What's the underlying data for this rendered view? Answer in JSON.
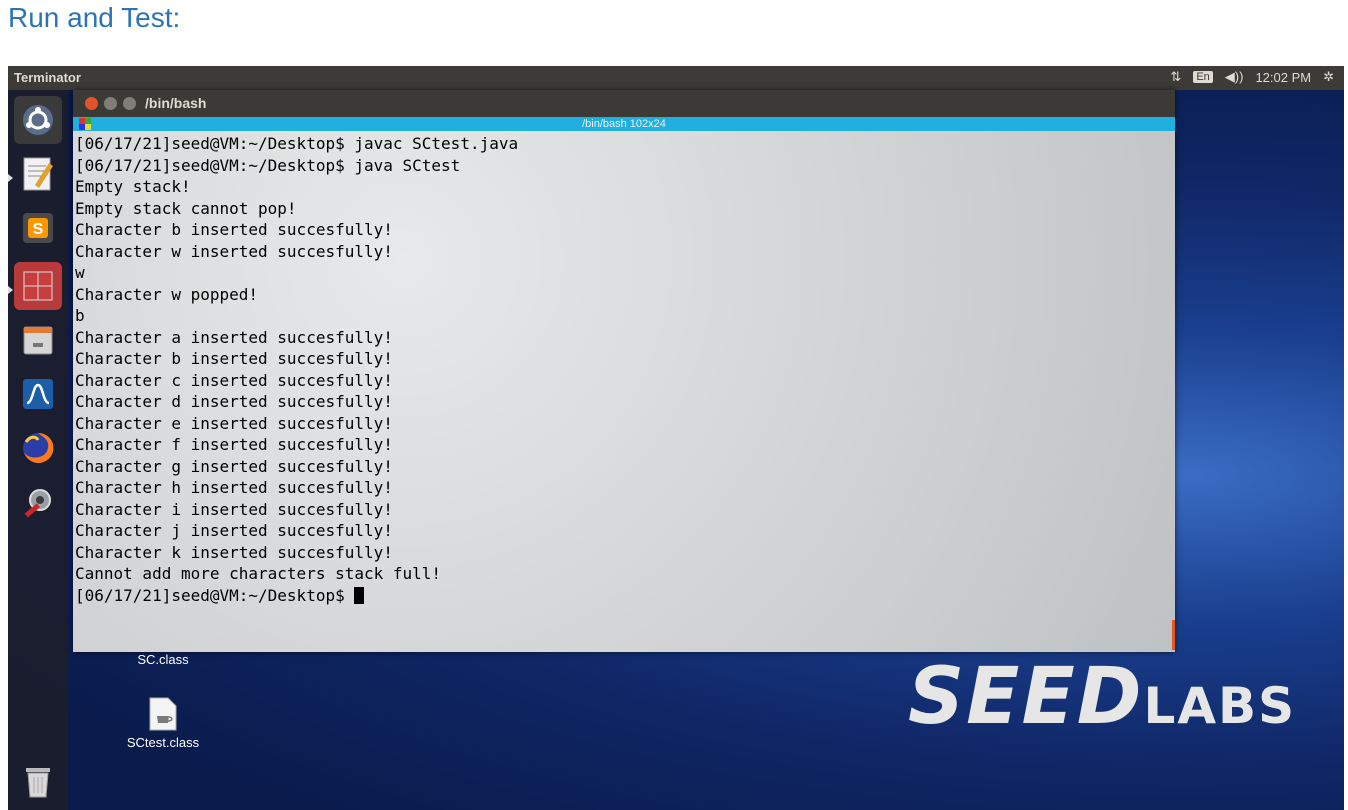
{
  "page": {
    "heading": "Run and Test:"
  },
  "topbar": {
    "app_title": "Terminator",
    "lang": "En",
    "time": "12:02 PM"
  },
  "launcher": {
    "items": [
      {
        "name": "ubuntu-logo-icon"
      },
      {
        "name": "text-editor-icon"
      },
      {
        "name": "sublime-text-icon"
      },
      {
        "name": "terminator-icon"
      },
      {
        "name": "file-manager-icon"
      },
      {
        "name": "wireshark-icon"
      },
      {
        "name": "firefox-icon"
      },
      {
        "name": "settings-icon"
      },
      {
        "name": "trash-icon"
      }
    ]
  },
  "window": {
    "title": "/bin/bash",
    "tab_title": "/bin/bash 102x24"
  },
  "terminal": {
    "lines": [
      "[06/17/21]seed@VM:~/Desktop$ javac SCtest.java",
      "[06/17/21]seed@VM:~/Desktop$ java SCtest",
      "Empty stack!",
      "Empty stack cannot pop!",
      "Character b inserted succesfully!",
      "Character w inserted succesfully!",
      "w",
      "Character w popped!",
      "b",
      "Character a inserted succesfully!",
      "Character b inserted succesfully!",
      "Character c inserted succesfully!",
      "Character d inserted succesfully!",
      "Character e inserted succesfully!",
      "Character f inserted succesfully!",
      "Character g inserted succesfully!",
      "Character h inserted succesfully!",
      "Character i inserted succesfully!",
      "Character j inserted succesfully!",
      "Character k inserted succesfully!",
      "Cannot add more characters stack full!"
    ],
    "prompt": "[06/17/21]seed@VM:~/Desktop$ "
  },
  "desktop": {
    "icons": [
      {
        "label": "SC.class"
      },
      {
        "label": "SCtest.class"
      }
    ],
    "wallpaper_logo_main": "SEED",
    "wallpaper_logo_sub": "LABS"
  }
}
